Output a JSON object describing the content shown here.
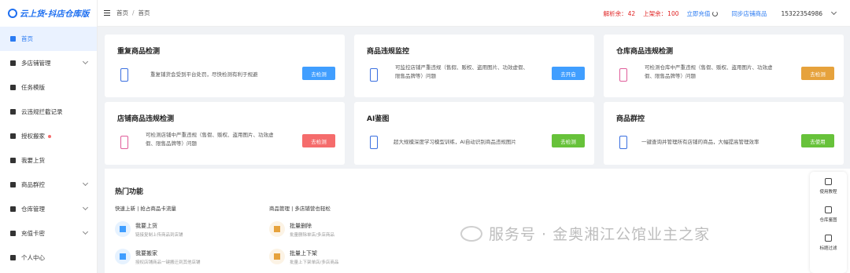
{
  "app": {
    "logo": "云上货-抖店仓库版"
  },
  "sidebar": {
    "items": [
      {
        "label": "首页",
        "active": true,
        "arrow": false,
        "icon": "home-icon"
      },
      {
        "label": "多店铺管理",
        "arrow": true,
        "icon": "store-icon"
      },
      {
        "label": "任务模版",
        "arrow": false,
        "icon": "clipboard-icon"
      },
      {
        "label": "云违规拦截记录",
        "arrow": false,
        "icon": "shield-icon"
      },
      {
        "label": "授权搬家",
        "arrow": false,
        "dot": true,
        "icon": "move-icon"
      },
      {
        "label": "我要上货",
        "arrow": false,
        "icon": "cloud-upload-icon"
      },
      {
        "label": "商品群控",
        "arrow": true,
        "icon": "grid-icon"
      },
      {
        "label": "仓库管理",
        "arrow": true,
        "icon": "warehouse-icon"
      },
      {
        "label": "充值卡密",
        "arrow": true,
        "icon": "card-icon"
      },
      {
        "label": "个人中心",
        "arrow": false,
        "icon": "user-icon"
      }
    ]
  },
  "header": {
    "breadcrumb": [
      "首页",
      "首页"
    ],
    "violation_label": "解析余：",
    "violation_count": "42",
    "listing_label": "上架余：",
    "listing_count": "100",
    "refresh": "立即充值",
    "sync": "同步店铺商品",
    "user": "15322354986"
  },
  "cards": [
    {
      "title": "重复商品检测",
      "desc": "重复铺货会受到平台处罚，尽快检测有利于规避",
      "button": "去检测",
      "btn_color": "blue"
    },
    {
      "title": "商品违规监控",
      "desc": "可监控店铺严重违规（售假、贩权、盗用图片、功效虚假、限售品牌等）问题",
      "button": "去开启",
      "btn_color": "blue"
    },
    {
      "title": "仓库商品违规检测",
      "desc": "可检测仓库中严重违规（售假、贩权、盗用图片、功效虚假、限售品牌等）问题",
      "button": "去检测",
      "btn_color": "orange"
    },
    {
      "title": "店铺商品违规检测",
      "desc": "可检测店铺中严重违规（售假、贩权、盗用图片、功效虚假、限售品牌等）问题",
      "button": "去检测",
      "btn_color": "red"
    },
    {
      "title": "AI鉴图",
      "desc": "超大规模深度学习模型训练，AI自动识别商品违规图片",
      "button": "去检测",
      "btn_color": "green"
    },
    {
      "title": "商品群控",
      "desc": "一键查询并管理所有店铺的商品，大幅提高管理效率",
      "button": "去使用",
      "btn_color": "green"
    }
  ],
  "hot": {
    "title": "热门功能",
    "col1_title": "快速上新 | 抢占商品卡流量",
    "col2_title": "商品管理 | 多店铺营也轻松",
    "features": [
      {
        "title": "我要上货",
        "desc": "链接复制上传商品到店铺",
        "icon": "send-icon",
        "color": "#409eff"
      },
      {
        "title": "我要搬家",
        "desc": "授权店铺商品一键搬迁到其他店铺",
        "icon": "clipboard-check-icon",
        "color": "#409eff"
      },
      {
        "title": "批量删除",
        "desc": "批量删除单店/多店商品",
        "icon": "trash-icon",
        "color": "#e6a23c"
      },
      {
        "title": "批量上下架",
        "desc": "批量上下架单店/多店商品",
        "icon": "send-icon",
        "color": "#e6a23c"
      }
    ]
  },
  "float": {
    "items": [
      {
        "label": "使用教程",
        "icon": "book-icon"
      },
      {
        "label": "仓库鉴图",
        "icon": "check-circle-icon"
      },
      {
        "label": "标题过滤",
        "icon": "folder-icon"
      }
    ]
  },
  "watermark": "服务号 · 金奥湘江公馆业主之家"
}
